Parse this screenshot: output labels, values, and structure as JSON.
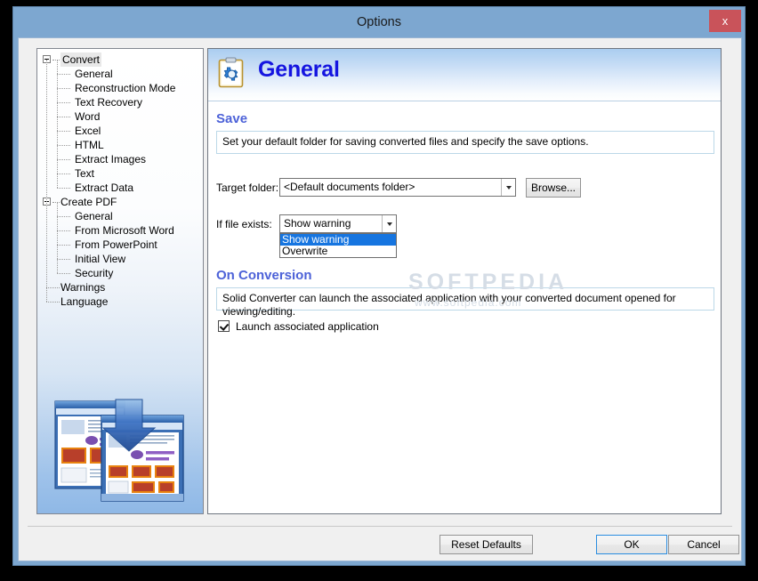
{
  "window": {
    "title": "Options",
    "close_label": "x"
  },
  "sidebar": {
    "tree": [
      {
        "label": "Convert",
        "level": 0,
        "expanded": true
      },
      {
        "label": "General",
        "level": 1
      },
      {
        "label": "Reconstruction Mode",
        "level": 1
      },
      {
        "label": "Text Recovery",
        "level": 1
      },
      {
        "label": "Word",
        "level": 1
      },
      {
        "label": "Excel",
        "level": 1
      },
      {
        "label": "HTML",
        "level": 1
      },
      {
        "label": "Extract Images",
        "level": 1
      },
      {
        "label": "Text",
        "level": 1
      },
      {
        "label": "Extract Data",
        "level": 1
      },
      {
        "label": "Create PDF",
        "level": 0,
        "expanded": true
      },
      {
        "label": "General",
        "level": 1
      },
      {
        "label": "From Microsoft Word",
        "level": 1
      },
      {
        "label": "From PowerPoint",
        "level": 1
      },
      {
        "label": "Initial View",
        "level": 1
      },
      {
        "label": "Security",
        "level": 1
      },
      {
        "label": "Warnings",
        "level": 0
      },
      {
        "label": "Language",
        "level": 0
      }
    ],
    "illustration_alt": "pdf-to-word-conversion-illustration"
  },
  "main": {
    "page_title": "General",
    "page_icon": "clipboard-gear-icon",
    "save_section": {
      "heading": "Save",
      "description": "Set your default folder for saving converted files and specify the save options.",
      "target_folder_label": "Target folder:",
      "target_folder_value": "<Default documents folder>",
      "browse_label": "Browse...",
      "if_file_exists_label": "If file exists:",
      "if_file_exists_value": "Show warning",
      "if_file_exists_options": [
        "Show warning",
        "Overwrite"
      ]
    },
    "conversion_section": {
      "heading": "On Conversion",
      "description": "Solid Converter can launch the associated application with your converted document opened for viewing/editing.",
      "launch_checkbox_label": "Launch associated application",
      "launch_checkbox_checked": true
    }
  },
  "footer": {
    "reset_label": "Reset Defaults",
    "ok_label": "OK",
    "cancel_label": "Cancel"
  },
  "watermark": {
    "brand": "SOFTPEDIA",
    "url": "www.softpedia.com"
  },
  "colors": {
    "titlebar": "#7da7d0",
    "close_button": "#c9535a",
    "heading_blue": "#4d62d8",
    "title_blue": "#1515e0",
    "selection_blue": "#1675e0",
    "default_button_border": "#2a8de0"
  }
}
